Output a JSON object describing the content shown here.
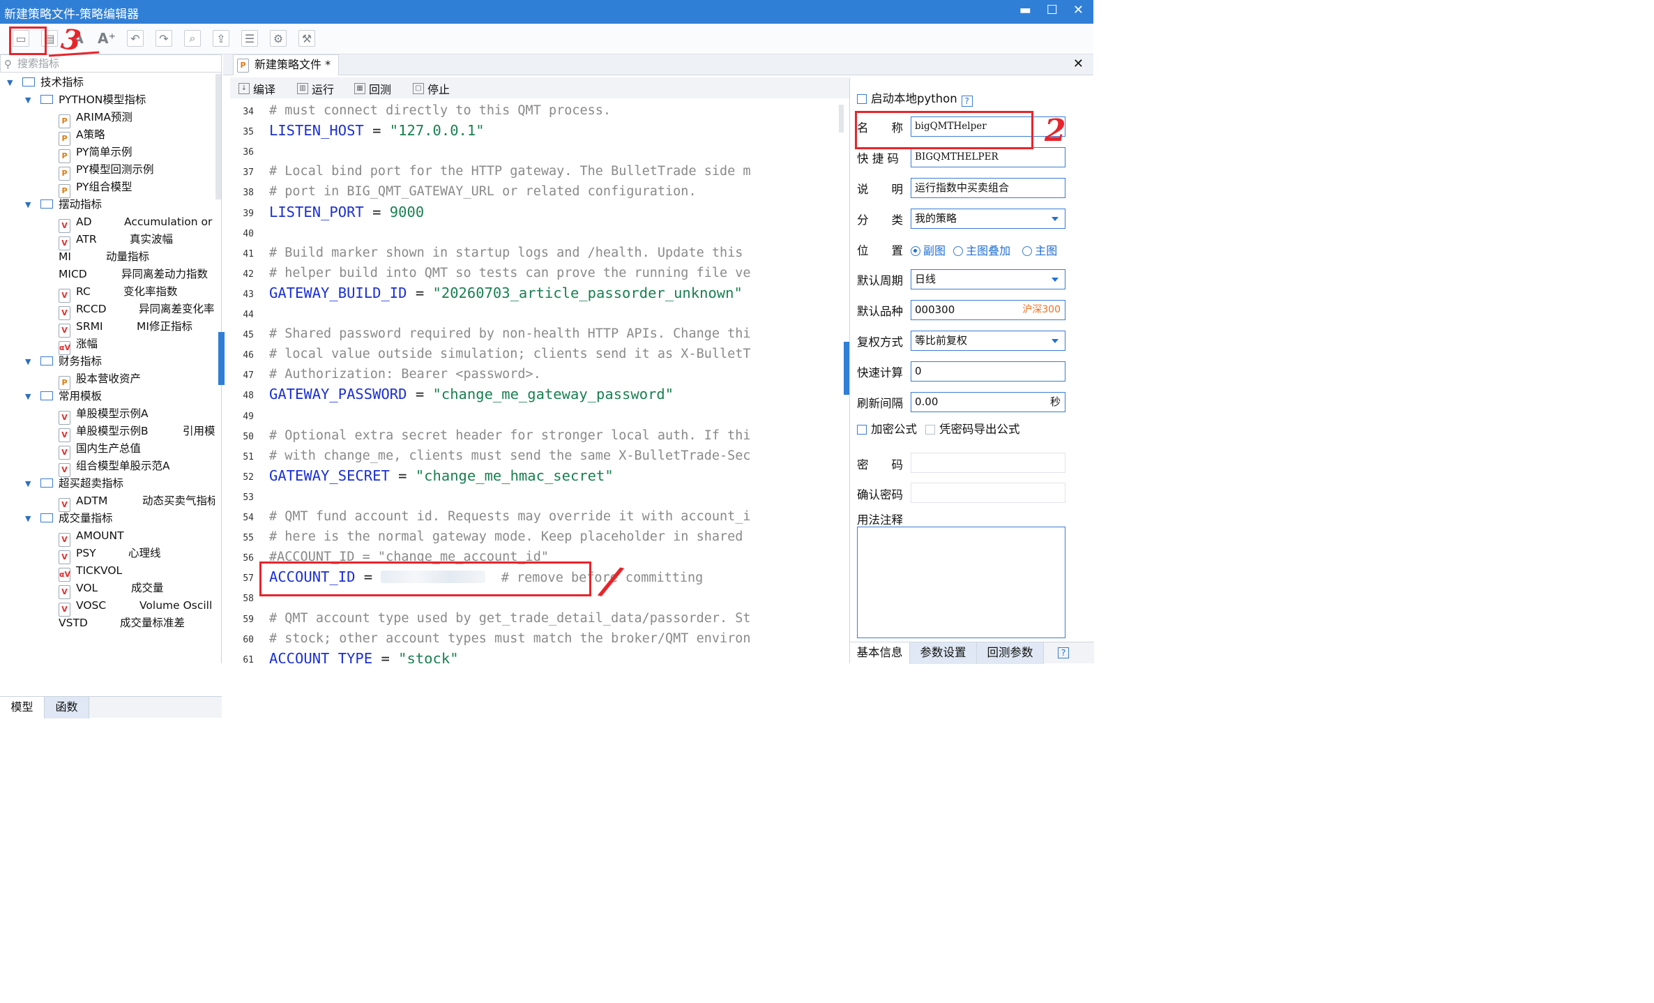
{
  "window": {
    "title": "新建策略文件-策略编辑器",
    "minimize": "▬",
    "maximize": "☐",
    "close": "✕"
  },
  "toolbar": {
    "icons": [
      "save-icon",
      "save-as-icon",
      "font-decrease-icon",
      "font-increase-icon",
      "undo-icon",
      "redo-icon",
      "find-icon",
      "export-icon",
      "import-icon",
      "settings-icon",
      "params-icon"
    ],
    "font_increase_label": "A⁺"
  },
  "search": {
    "placeholder": "搜索指标"
  },
  "tree": {
    "tech": "技术指标",
    "python_group": "PYTHON模型指标",
    "py_items": [
      "ARIMA预测",
      "A策略",
      "PY简单示例",
      "PY模型回测示例",
      "PY组合模型"
    ],
    "swing_group": "摆动指标",
    "swing_items": [
      {
        "name": "AD",
        "desc": "Accumulation or"
      },
      {
        "name": "ATR",
        "desc": "真实波幅"
      },
      {
        "name": "MI",
        "desc": "动量指标"
      },
      {
        "name": "MICD",
        "desc": "异同离差动力指数"
      },
      {
        "name": "RC",
        "desc": "变化率指数"
      },
      {
        "name": "RCCD",
        "desc": "异同离差变化率"
      },
      {
        "name": "SRMI",
        "desc": "MI修正指标"
      },
      {
        "name": "涨幅",
        "desc": ""
      }
    ],
    "finance_group": "财务指标",
    "finance_items": [
      "股本营收资产"
    ],
    "template_group": "常用模板",
    "template_items": [
      {
        "name": "单股模型示例A",
        "desc": ""
      },
      {
        "name": "单股模型示例B",
        "desc": "引用模"
      },
      {
        "name": "国内生产总值",
        "desc": ""
      },
      {
        "name": "组合模型单股示范A",
        "desc": ""
      }
    ],
    "overbought_group": "超买超卖指标",
    "overbought_items": [
      {
        "name": "ADTM",
        "desc": "动态买卖气指标"
      }
    ],
    "volume_group": "成交量指标",
    "volume_items": [
      {
        "name": "AMOUNT",
        "desc": ""
      },
      {
        "name": "PSY",
        "desc": "心理线"
      },
      {
        "name": "TICKVOL",
        "desc": ""
      },
      {
        "name": "VOL",
        "desc": "成交量"
      },
      {
        "name": "VOSC",
        "desc": "Volume Oscill"
      },
      {
        "name": "VSTD",
        "desc": "成交量标准差"
      }
    ]
  },
  "left_tabs": [
    "模型",
    "函数"
  ],
  "editor": {
    "tab_title": "新建策略文件 *",
    "close": "✕",
    "commands": [
      "编译",
      "运行",
      "回测",
      "停止"
    ],
    "lines": [
      {
        "n": "34",
        "t": "# must connect directly to this QMT process.",
        "k": "c"
      },
      {
        "n": "35",
        "a": "LISTEN_HOST",
        "b": " = ",
        "s": "\"127.0.0.1\"",
        "k": "a"
      },
      {
        "n": "36",
        "t": "",
        "k": "c"
      },
      {
        "n": "37",
        "t": "# Local bind port for the HTTP gateway. The BulletTrade side m",
        "k": "c"
      },
      {
        "n": "38",
        "t": "# port in BIG_QMT_GATEWAY_URL or related configuration.",
        "k": "c"
      },
      {
        "n": "39",
        "a": "LISTEN_PORT",
        "b": " = ",
        "s": "9000",
        "k": "a"
      },
      {
        "n": "40",
        "t": "",
        "k": "c"
      },
      {
        "n": "41",
        "t": "# Build marker shown in startup logs and /health. Update this",
        "k": "c"
      },
      {
        "n": "42",
        "t": "# helper build into QMT so tests can prove the running file ve",
        "k": "c"
      },
      {
        "n": "43",
        "a": "GATEWAY_BUILD_ID",
        "b": " = ",
        "s": "\"20260703_article_passorder_unknown\"",
        "k": "a"
      },
      {
        "n": "44",
        "t": "",
        "k": "c"
      },
      {
        "n": "45",
        "t": "# Shared password required by non-health HTTP APIs. Change thi",
        "k": "c"
      },
      {
        "n": "46",
        "t": "# local value outside simulation; clients send it as X-BulletT",
        "k": "c"
      },
      {
        "n": "47",
        "t": "# Authorization: Bearer <password>.",
        "k": "c"
      },
      {
        "n": "48",
        "a": "GATEWAY_PASSWORD",
        "b": " = ",
        "s": "\"change_me_gateway_password\"",
        "k": "a"
      },
      {
        "n": "49",
        "t": "",
        "k": "c"
      },
      {
        "n": "50",
        "t": "# Optional extra secret header for stronger local auth. If thi",
        "k": "c"
      },
      {
        "n": "51",
        "t": "# with change_me, clients must send the same X-BulletTrade-Sec",
        "k": "c"
      },
      {
        "n": "52",
        "a": "GATEWAY_SECRET",
        "b": " = ",
        "s": "\"change_me_hmac_secret\"",
        "k": "a"
      },
      {
        "n": "53",
        "t": "",
        "k": "c"
      },
      {
        "n": "54",
        "t": "# QMT fund account id. Requests may override it with account_i",
        "k": "c"
      },
      {
        "n": "55",
        "t": "# here is the normal gateway mode. Keep placeholder in shared",
        "k": "c"
      },
      {
        "n": "56",
        "t": "#ACCOUNT_ID = \"change_me_account_id\"",
        "k": "c"
      },
      {
        "n": "57",
        "a": "ACCOUNT_ID",
        "b": " = ",
        "s": "",
        "r": "  # remove before committing",
        "k": "r"
      },
      {
        "n": "58",
        "t": "",
        "k": "c"
      },
      {
        "n": "59",
        "t": "# QMT account type used by get_trade_detail_data/passorder. St",
        "k": "c"
      },
      {
        "n": "60",
        "t": "# stock; other account types must match the broker/QMT environ",
        "k": "c"
      },
      {
        "n": "61",
        "a": "ACCOUNT_TYPE",
        "b": " = ",
        "s": "\"stock\"",
        "k": "a"
      }
    ]
  },
  "props": {
    "local_python": "启动本地python",
    "help": "?",
    "name_label": "名　　称",
    "name_value": "bigQMTHelper",
    "shortcut_label": "快 捷 码",
    "shortcut_value": "BIGQMTHELPER",
    "desc_label": "说　　明",
    "desc_value": "运行指数中买卖组合",
    "category_label": "分　　类",
    "category_value": "我的策略",
    "position_label": "位　　置",
    "position_options": [
      "副图",
      "主图叠加",
      "主图"
    ],
    "period_label": "默认周期",
    "period_value": "日线",
    "symbol_label": "默认品种",
    "symbol_value": "000300",
    "symbol_market": "沪深300",
    "adjust_label": "复权方式",
    "adjust_value": "等比前复权",
    "quick_label": "快速计算",
    "quick_value": "0",
    "refresh_label": "刷新间隔",
    "refresh_value": "0.00",
    "refresh_unit": "秒",
    "encrypt_label": "加密公式",
    "export_label": "凭密码导出公式",
    "password_label": "密　　码",
    "confirm_label": "确认密码",
    "notes_label": "用法注释",
    "tabs": [
      "基本信息",
      "参数设置",
      "回测参数"
    ],
    "tab_help": "?"
  },
  "colors": {
    "accent": "#2f7fd6",
    "annotation": "#e8242b",
    "string": "#188050",
    "keyword": "#1a2fd6",
    "comment": "#8a8a8a"
  }
}
